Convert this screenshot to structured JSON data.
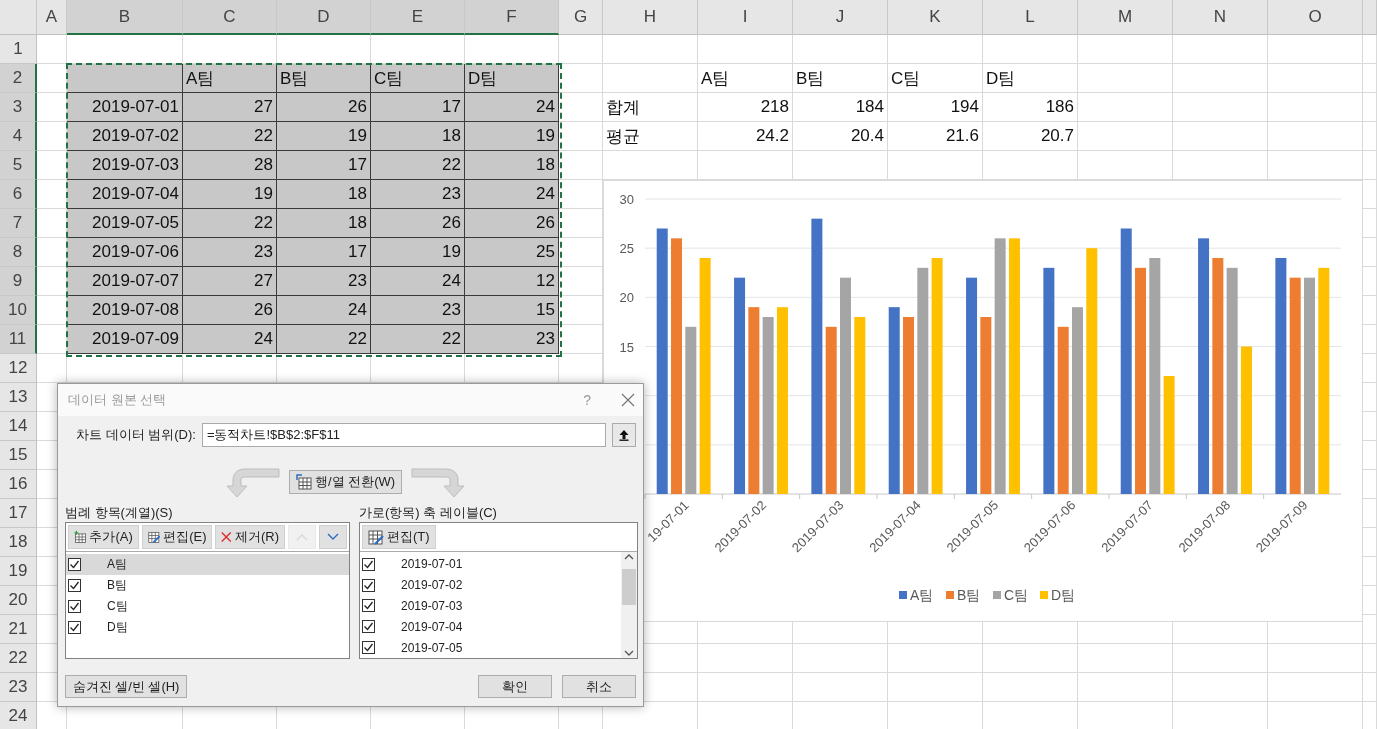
{
  "sheet": {
    "columns": [
      "A",
      "B",
      "C",
      "D",
      "E",
      "F",
      "G",
      "H",
      "I",
      "J",
      "K",
      "L",
      "M",
      "N",
      "O"
    ],
    "row_headers": [
      "1",
      "2",
      "3",
      "4",
      "5",
      "6",
      "7",
      "8",
      "9",
      "10",
      "11",
      "12",
      "13",
      "14",
      "15",
      "16",
      "17",
      "18",
      "19",
      "20",
      "21",
      "22",
      "23",
      "24"
    ],
    "data_range": {
      "selected": true,
      "header": [
        "A팀",
        "B팀",
        "C팀",
        "D팀"
      ],
      "rows": [
        {
          "date": "2019-07-01",
          "values": [
            "27",
            "26",
            "17",
            "24"
          ]
        },
        {
          "date": "2019-07-02",
          "values": [
            "22",
            "19",
            "18",
            "19"
          ]
        },
        {
          "date": "2019-07-03",
          "values": [
            "28",
            "17",
            "22",
            "18"
          ]
        },
        {
          "date": "2019-07-04",
          "values": [
            "19",
            "18",
            "23",
            "24"
          ]
        },
        {
          "date": "2019-07-05",
          "values": [
            "22",
            "18",
            "26",
            "26"
          ]
        },
        {
          "date": "2019-07-06",
          "values": [
            "23",
            "17",
            "19",
            "25"
          ]
        },
        {
          "date": "2019-07-07",
          "values": [
            "27",
            "23",
            "24",
            "12"
          ]
        },
        {
          "date": "2019-07-08",
          "values": [
            "26",
            "24",
            "23",
            "15"
          ]
        },
        {
          "date": "2019-07-09",
          "values": [
            "24",
            "22",
            "22",
            "23"
          ]
        }
      ]
    },
    "summary": {
      "header": [
        "A팀",
        "B팀",
        "C팀",
        "D팀"
      ],
      "rows": [
        {
          "label": "합계",
          "values": [
            "218",
            "184",
            "194",
            "186"
          ]
        },
        {
          "label": "평균",
          "values": [
            "24.2",
            "20.4",
            "21.6",
            "20.7"
          ]
        }
      ]
    }
  },
  "chart": {
    "chart_data": {
      "type": "bar",
      "grid": true,
      "legend": true,
      "categories": [
        "19-07-01",
        "2019-07-02",
        "2019-07-03",
        "2019-07-04",
        "2019-07-05",
        "2019-07-06",
        "2019-07-07",
        "2019-07-08",
        "2019-07-09"
      ],
      "series": [
        {
          "name": "A팀",
          "color": "#4472c4",
          "values": [
            27,
            22,
            28,
            19,
            22,
            23,
            27,
            26,
            24
          ]
        },
        {
          "name": "B팀",
          "color": "#ed7d31",
          "values": [
            26,
            19,
            17,
            18,
            18,
            17,
            23,
            24,
            22
          ]
        },
        {
          "name": "C팀",
          "color": "#a5a5a5",
          "values": [
            17,
            18,
            22,
            23,
            26,
            19,
            24,
            23,
            22
          ]
        },
        {
          "name": "D팀",
          "color": "#ffc000",
          "values": [
            24,
            19,
            18,
            24,
            26,
            25,
            12,
            15,
            23
          ]
        }
      ],
      "ylim": [
        0,
        30
      ],
      "yticks": [
        15,
        20,
        25,
        30
      ]
    }
  },
  "dialog": {
    "title": "데이터 원본 선택",
    "help": "?",
    "range_label": "차트 데이터 범위(D):",
    "range_value": "=동적차트!$B$2:$F$11",
    "switch_button": "행/열 전환(W)",
    "series_panel": {
      "label": "범례 항목(계열)(S)",
      "buttons": [
        {
          "label": "추가(A)",
          "kind": "add"
        },
        {
          "label": "편집(E)",
          "kind": "edit"
        },
        {
          "label": "제거(R)",
          "kind": "remove"
        }
      ],
      "move_up": {
        "disabled": true
      },
      "move_down": {
        "disabled": false
      },
      "items": [
        {
          "label": "A팀",
          "checked": true,
          "selected": true
        },
        {
          "label": "B팀",
          "checked": true,
          "selected": false
        },
        {
          "label": "C팀",
          "checked": true,
          "selected": false
        },
        {
          "label": "D팀",
          "checked": true,
          "selected": false
        }
      ]
    },
    "category_panel": {
      "label": "가로(항목) 축 레이블(C)",
      "buttons": [
        {
          "label": "편집(T)",
          "kind": "edit"
        }
      ],
      "items": [
        {
          "label": "2019-07-01",
          "checked": true
        },
        {
          "label": "2019-07-02",
          "checked": true
        },
        {
          "label": "2019-07-03",
          "checked": true
        },
        {
          "label": "2019-07-04",
          "checked": true
        },
        {
          "label": "2019-07-05",
          "checked": true
        }
      ]
    },
    "hidden_cells_button": "숨겨진 셀/빈 셀(H)",
    "ok_button": "확인",
    "cancel_button": "취소"
  }
}
